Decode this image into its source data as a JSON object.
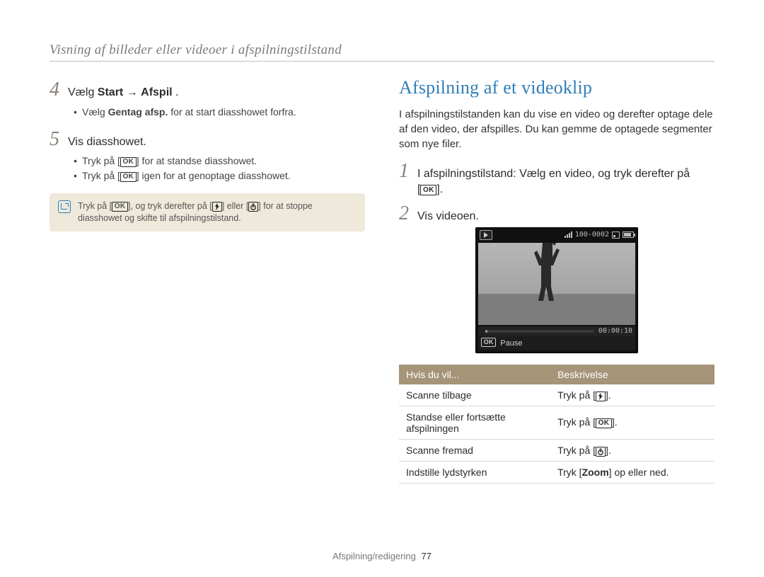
{
  "breadcrumb": "Visning af billeder eller videoer i afspilningstilstand",
  "left": {
    "step4": {
      "num": "4",
      "prefix": "Vælg ",
      "bold1": "Start",
      "arrow": " → ",
      "bold2": "Afspil",
      "suffix": " ."
    },
    "step4_bullets": [
      {
        "prefix": "Vælg ",
        "bold": "Gentag afsp.",
        "suffix": " for at start diasshowet forfra."
      }
    ],
    "step5": {
      "num": "5",
      "text": "Vis diasshowet."
    },
    "step5_bullets": [
      {
        "pre": "Tryk på [",
        "ok": "OK",
        "post": "] for at standse diasshowet."
      },
      {
        "pre": "Tryk på [",
        "ok": "OK",
        "post": "] igen for at genoptage diasshowet."
      }
    ],
    "note": {
      "pre": "Tryk på [",
      "ok": "OK",
      "mid1": "], og tryk derefter på [",
      "icon1": "flash-icon",
      "mid2": "] eller [",
      "icon2": "timer-icon",
      "post": "] for at stoppe diasshowet og skifte til afspilningstilstand."
    }
  },
  "right": {
    "heading": "Afspilning af et videoklip",
    "intro": "I afspilningstilstanden kan du vise en video og derefter optage dele af den video, der afspilles. Du kan gemme de optagede segmenter som nye filer.",
    "step1": {
      "num": "1",
      "line1_pre": "I afspilningstilstand: Vælg en video, og tryk derefter på",
      "line2_pre": "[",
      "ok": "OK",
      "line2_post": "]."
    },
    "step2": {
      "num": "2",
      "text": "Vis videoen."
    },
    "screen": {
      "counter": "100-0002",
      "time": "00:00:10",
      "pause_label": "Pause",
      "ok": "OK"
    },
    "table": {
      "h1": "Hvis du vil...",
      "h2": "Beskrivelse",
      "rows": [
        {
          "action": "Scanne tilbage",
          "desc_pre": "Tryk på [",
          "icon": "flash-icon",
          "desc_post": "]."
        },
        {
          "action": "Standse eller fortsætte afspilningen",
          "desc_pre": "Tryk på [",
          "ok": "OK",
          "desc_post": "]."
        },
        {
          "action": "Scanne fremad",
          "desc_pre": "Tryk på [",
          "icon": "timer-icon",
          "desc_post": "]."
        },
        {
          "action": "Indstille lydstyrken",
          "desc_pre": "Tryk [",
          "bold": "Zoom",
          "desc_post": "] op eller ned."
        }
      ]
    }
  },
  "footer": {
    "section": "Afspilning/redigering",
    "page": "77"
  }
}
